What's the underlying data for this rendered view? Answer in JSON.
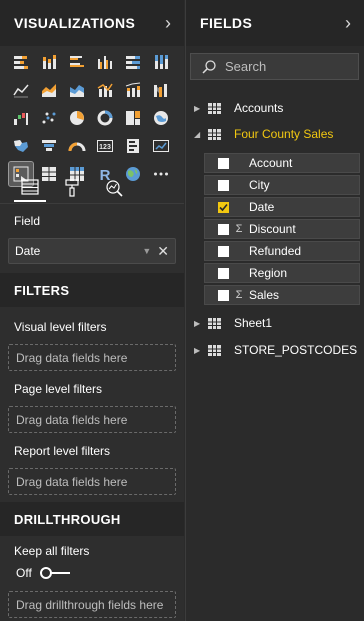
{
  "visualizations": {
    "title": "VISUALIZATIONS",
    "expand_icon": "chevron-right-icon",
    "icons": [
      "stacked-bar-chart-icon",
      "stacked-column-chart-icon",
      "clustered-bar-chart-icon",
      "clustered-column-chart-icon",
      "100-percent-bar-chart-icon",
      "100-percent-column-chart-icon",
      "line-chart-icon",
      "area-chart-icon",
      "stacked-area-chart-icon",
      "line-column-chart-icon",
      "line-stacked-column-chart-icon",
      "ribbon-chart-icon",
      "waterfall-chart-icon",
      "scatter-chart-icon",
      "pie-chart-icon",
      "donut-chart-icon",
      "treemap-icon",
      "map-icon",
      "filled-map-icon",
      "funnel-icon",
      "gauge-icon",
      "card-icon",
      "multi-row-card-icon",
      "kpi-icon",
      "slicer-icon",
      "table-icon",
      "matrix-icon",
      "r-visual-icon",
      "arcgis-map-icon",
      "more-visuals-icon"
    ],
    "selected_index": 24,
    "tabs": [
      "fields-tab-icon",
      "format-tab-icon",
      "analytics-tab-icon"
    ],
    "field_label": "Field",
    "field_value": "Date"
  },
  "filters": {
    "title": "FILTERS",
    "visual_level": "Visual level filters",
    "visual_placeholder": "Drag data fields here",
    "page_level": "Page level filters",
    "page_placeholder": "Drag data fields here",
    "report_level": "Report level filters",
    "report_placeholder": "Drag data fields here"
  },
  "drillthrough": {
    "title": "DRILLTHROUGH",
    "keep_all": "Keep all filters",
    "toggle_state": "Off",
    "placeholder": "Drag drillthrough fields here"
  },
  "fields": {
    "title": "FIELDS",
    "expand_icon": "chevron-right-icon",
    "search_placeholder": "Search",
    "tables": [
      {
        "name": "Accounts",
        "expanded": false
      },
      {
        "name": "Four County Sales",
        "expanded": true
      },
      {
        "name": "Sheet1",
        "expanded": false
      },
      {
        "name": "STORE_POSTCODES",
        "expanded": false
      }
    ],
    "columns": [
      {
        "name": "Account",
        "checked": false,
        "sigma": false
      },
      {
        "name": "City",
        "checked": false,
        "sigma": false
      },
      {
        "name": "Date",
        "checked": true,
        "sigma": false
      },
      {
        "name": "Discount",
        "checked": false,
        "sigma": true
      },
      {
        "name": "Refunded",
        "checked": false,
        "sigma": false
      },
      {
        "name": "Region",
        "checked": false,
        "sigma": false
      },
      {
        "name": "Sales",
        "checked": false,
        "sigma": true
      }
    ],
    "sigma_symbol": "Σ"
  },
  "colors": {
    "accent": "#f2c811",
    "pane_bg": "#2e2e2e",
    "header_bg": "#262626"
  }
}
